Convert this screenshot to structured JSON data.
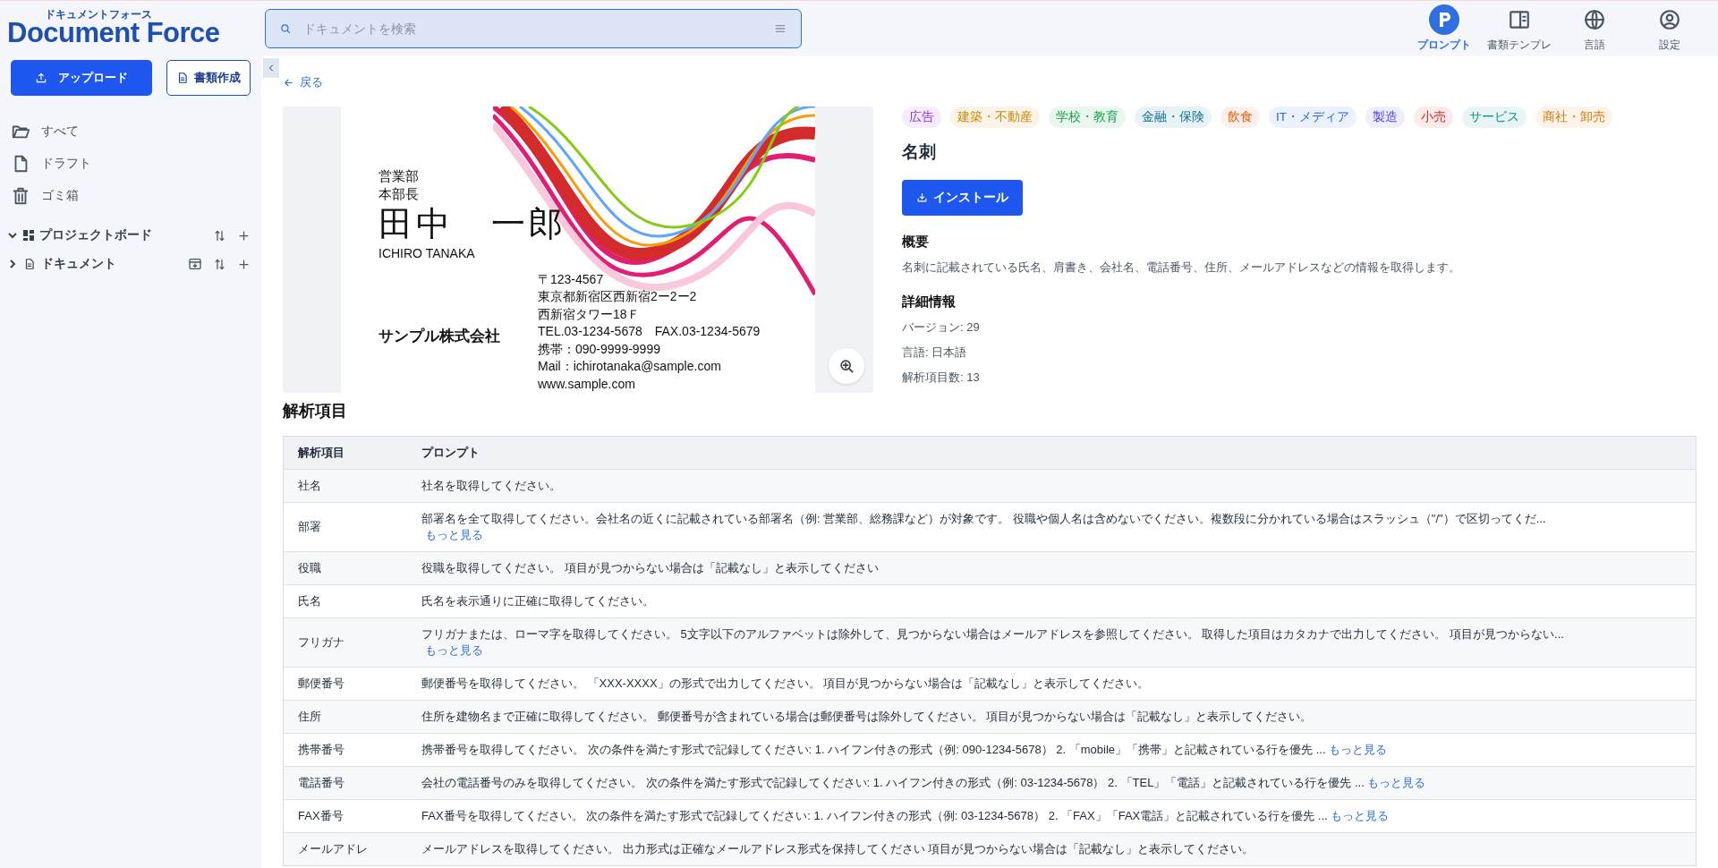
{
  "logo": {
    "ruby": "ドキュメントフォース",
    "name": "Document Force"
  },
  "search": {
    "placeholder": "ドキュメントを検索"
  },
  "top_nav": [
    {
      "label": "プロンプト",
      "selected": true
    },
    {
      "label": "書類テンプレ",
      "selected": false
    },
    {
      "label": "言語",
      "selected": false
    },
    {
      "label": "設定",
      "selected": false
    }
  ],
  "sidebar": {
    "upload_button": "アップロード",
    "create_button": "書類作成",
    "items": [
      {
        "label": "すべて"
      },
      {
        "label": "ドラフト"
      },
      {
        "label": "ゴミ箱"
      }
    ],
    "sections": [
      {
        "label": "プロジェクトボード",
        "expanded": true
      },
      {
        "label": "ドキュメント",
        "expanded": false
      }
    ]
  },
  "back_link": "戻る",
  "card": {
    "department": "営業部",
    "position": "本部長",
    "name": "田中　一郎",
    "name_roman": "ICHIRO TANAKA",
    "company": "サンプル株式会社",
    "lines": [
      "〒123-4567",
      "東京都新宿区西新宿2ー2ー2",
      "西新宿タワー18Ｆ",
      "TEL.03-1234-5678　FAX.03-1234-5679",
      "携帯：090-9999-9999",
      "Mail：ichirotanaka@sample.com",
      "www.sample.com"
    ]
  },
  "tags": [
    {
      "label": "広告",
      "color": "#9333ea"
    },
    {
      "label": "建築・不動産",
      "color": "#ca8a04"
    },
    {
      "label": "学校・教育",
      "color": "#16a34a"
    },
    {
      "label": "金融・保険",
      "color": "#0e7490"
    },
    {
      "label": "飲食",
      "color": "#ea580c"
    },
    {
      "label": "IT・メディア",
      "color": "#2563eb"
    },
    {
      "label": "製造",
      "color": "#4f46e5"
    },
    {
      "label": "小売",
      "color": "#dc2626"
    },
    {
      "label": "サービス",
      "color": "#0d9488"
    },
    {
      "label": "商社・卸売",
      "color": "#d97706"
    }
  ],
  "template": {
    "title": "名刺",
    "install_button": "インストール",
    "overview_heading": "概要",
    "overview": "名刺に記載されている氏名、肩書き、会社名、電話番号、住所、メールアドレスなどの情報を取得します。",
    "details_heading": "詳細情報",
    "details": [
      "バージョン: 29",
      "言語: 日本語",
      "解析項目数: 13"
    ]
  },
  "fields": {
    "heading": "解析項目",
    "columns": [
      "解析項目",
      "プロンプト"
    ],
    "rows": [
      {
        "item": "社名",
        "prompt": "社名を取得してください。"
      },
      {
        "item": "部署",
        "prompt": "部署名を全て取得してください。会社名の近くに記載されている部署名（例: 営業部、総務課など）が対象です。 役職や個人名は含めないでください。複数段に分かれている場合はスラッシュ（\"/\"）で区切ってくだ...",
        "more": "もっと見る",
        "kind": "block"
      },
      {
        "item": "役職",
        "prompt": "役職を取得してください。 項目が見つからない場合は「記載なし」と表示してください"
      },
      {
        "item": "氏名",
        "prompt": "氏名を表示通りに正確に取得してください。"
      },
      {
        "item": "フリガナ",
        "prompt": "フリガナまたは、ローマ字を取得してください。 5文字以下のアルファベットは除外して、見つからない場合はメールアドレスを参照してください。 取得した項目はカタカナで出力してください。 項目が見つからない...",
        "more": "もっと見る",
        "kind": "block"
      },
      {
        "item": "郵便番号",
        "prompt": "郵便番号を取得してください。 「XXX-XXXX」の形式で出力してください。 項目が見つからない場合は「記載なし」と表示してください。"
      },
      {
        "item": "住所",
        "prompt": "住所を建物名まで正確に取得してください。 郵便番号が含まれている場合は郵便番号は除外してください。 項目が見つからない場合は「記載なし」と表示してください。"
      },
      {
        "item": "携帯番号",
        "prompt": "携帯番号を取得してください。 次の条件を満たす形式で記録してください: 1. ハイフン付きの形式（例: 090-1234-5678） 2. 「mobile」「携帯」と記載されている行を優先 ...",
        "more": "もっと見る",
        "kind": "inline"
      },
      {
        "item": "電話番号",
        "prompt": "会社の電話番号のみを取得してください。 次の条件を満たす形式で記録してください: 1. ハイフン付きの形式（例: 03-1234-5678） 2. 「TEL」「電話」と記載されている行を優先 ...",
        "more": "もっと見る",
        "kind": "inline"
      },
      {
        "item": "FAX番号",
        "prompt": "FAX番号を取得してください。 次の条件を満たす形式で記録してください: 1. ハイフン付きの形式（例: 03-1234-5678） 2. 「FAX」「FAX電話」と記載されている行を優先 ...",
        "more": "もっと見る",
        "kind": "inline"
      },
      {
        "item": "メールアドレ",
        "prompt": "メールアドレスを取得してください。 出力形式は正確なメールアドレス形式を保持してください 項目が見つからない場合は「記載なし」と表示してください。"
      }
    ]
  }
}
